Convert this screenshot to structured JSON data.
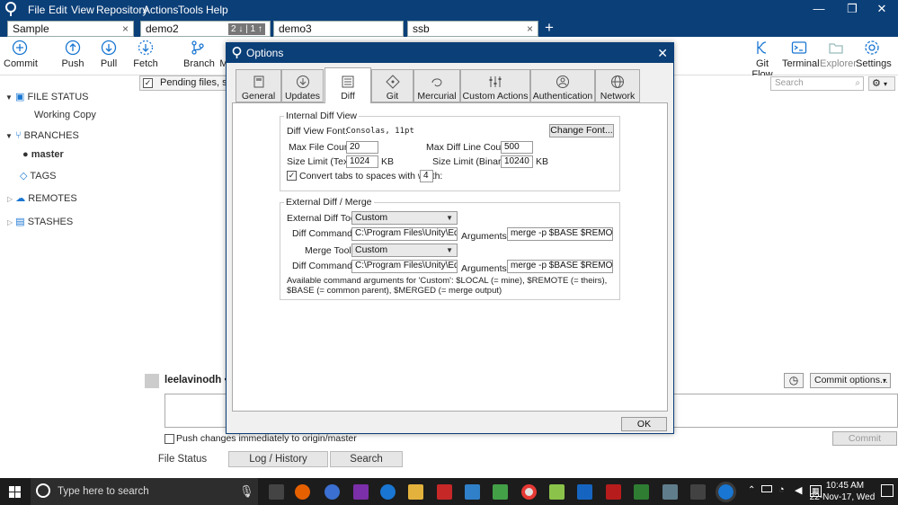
{
  "menu": {
    "file": "File",
    "edit": "Edit",
    "view": "View",
    "repository": "Repository",
    "actions": "Actions",
    "tools": "Tools",
    "help": "Help"
  },
  "window_controls": {
    "minimize": "—",
    "maximize": "❐",
    "close": "✕"
  },
  "repo_tabs": [
    {
      "label": "Sample"
    },
    {
      "label": "demo2",
      "badge": "2 ↓ | 1 ↑"
    },
    {
      "label": "demo3"
    },
    {
      "label": "ssb"
    }
  ],
  "add_tab": "+",
  "toolbar": {
    "commit": "Commit",
    "push": "Push",
    "pull": "Pull",
    "fetch": "Fetch",
    "branch": "Branch",
    "merge": "M",
    "git_flow": "Git Flow",
    "terminal": "Terminal",
    "explorer": "Explorer",
    "settings": "Settings"
  },
  "sidebar": {
    "file_status": "FILE STATUS",
    "working_copy": "Working Copy",
    "branches": "BRANCHES",
    "master": "master",
    "tags": "TAGS",
    "remotes": "REMOTES",
    "stashes": "STASHES"
  },
  "main": {
    "pending": "Pending files, sorted",
    "search_placeholder": "Search",
    "user": "leelavinodh <",
    "commit_options": "Commit options...",
    "push_changes": "Push changes immediately to origin/master",
    "commit_button": "Commit",
    "bottom_tabs": [
      "File Status",
      "Log / History",
      "Search"
    ]
  },
  "dialog": {
    "title": "Options",
    "tabs": [
      "General",
      "Updates",
      "Diff",
      "Git",
      "Mercurial",
      "Custom Actions",
      "Authentication",
      "Network"
    ],
    "internal": {
      "legend": "Internal Diff View",
      "font_label": "Diff View Font:",
      "font_value": "Consolas, 11pt",
      "change_font": "Change Font...",
      "max_file_count_label": "Max File Count:",
      "max_file_count": "20",
      "max_line_count_label": "Max Diff Line Count:",
      "max_line_count": "500",
      "size_text_label": "Size Limit (Text):",
      "size_text": "1024",
      "size_binary_label": "Size Limit (Binary):",
      "size_binary": "10240",
      "kb": "KB",
      "tabs_label": "Convert tabs to spaces with width:",
      "tabs_width": "4"
    },
    "external": {
      "legend": "External Diff / Merge",
      "diff_tool_label": "External Diff Tool:",
      "diff_tool": "Custom",
      "diff_command_label": "Diff Command:",
      "diff_command": "C:\\Program Files\\Unity\\Editor\\",
      "arguments_label": "Arguments:",
      "diff_arguments": "merge -p $BASE $REMOTE $LOCAL",
      "merge_tool_label": "Merge Tool:",
      "merge_tool": "Custom",
      "merge_command_label": "Diff Command:",
      "merge_command": "C:\\Program Files\\Unity\\Editor\\",
      "merge_arguments": "merge -p $BASE $REMOTE $LOCAL",
      "help_text": "Available command arguments for 'Custom': $LOCAL (= mine), $REMOTE (= theirs), $BASE (= common parent), $MERGED (= merge output)"
    },
    "ok": "OK"
  },
  "taskbar": {
    "search_placeholder": "Type here to search",
    "time": "10:45 AM",
    "date": "22-Nov-17, Wed"
  },
  "colors": {
    "titlebar": "#0b3f78",
    "taskbar": "#1c1c1c",
    "accent": "#1976d2"
  }
}
